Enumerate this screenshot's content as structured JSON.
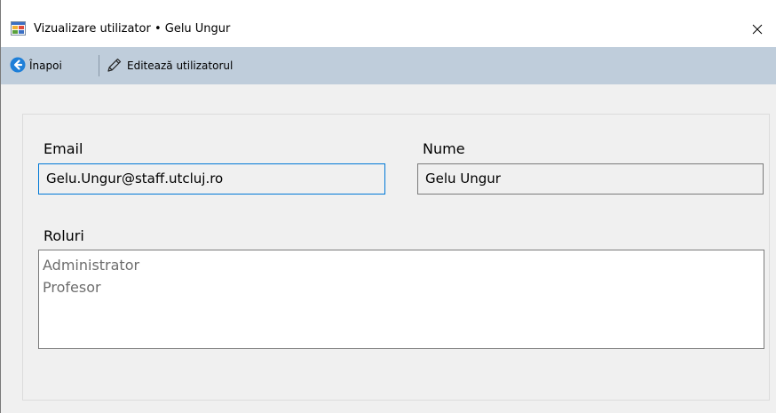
{
  "window": {
    "title": "Vizualizare utilizator • Gelu Ungur",
    "app_icon": "windows-form-icon",
    "close_icon": "close-icon"
  },
  "toolbar": {
    "back_label": "Înapoi",
    "back_icon": "arrow-left-circle-icon",
    "edit_label": "Editează utilizatorul",
    "edit_icon": "pencil-icon",
    "background_color": "#bfcddb"
  },
  "form": {
    "email_label": "Email",
    "email_value": "Gelu.Ungur@staff.utcluj.ro",
    "name_label": "Nume",
    "name_value": "Gelu Ungur",
    "roles_label": "Roluri",
    "roles": [
      "Administrator",
      "Profesor"
    ]
  },
  "colors": {
    "focus_border": "#0078d7",
    "back_icon_blue": "#1e7fd8"
  }
}
